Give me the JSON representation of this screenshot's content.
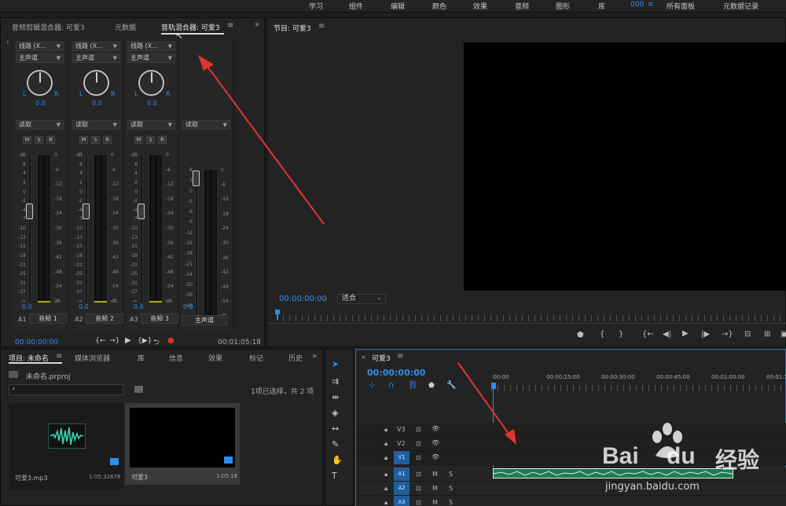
{
  "workspaces": [
    "学习",
    "组件",
    "编辑",
    "颜色",
    "效果",
    "音频",
    "图形",
    "库",
    "000",
    "所有面板",
    "元数据记录"
  ],
  "workspace_menu_glyph": "≡",
  "mixer_panel": {
    "tabs": [
      "音频剪辑混合器: 可爱3",
      "元数据",
      "音轨混合器: 可爱3"
    ],
    "menu_glyph": "≡",
    "expand_glyph": "»",
    "side_arrow": "›",
    "channels": [
      {
        "input": "线路 (X...",
        "output": "主声道",
        "pan": "0.0",
        "mode": "读取",
        "level": "0.0",
        "id": "A1",
        "name": "音频 1"
      },
      {
        "input": "线路 (X...",
        "output": "主声道",
        "pan": "0.0",
        "mode": "读取",
        "level": "0.0",
        "id": "A2",
        "name": "音频 2"
      },
      {
        "input": "线路 (X...",
        "output": "主声道",
        "pan": "0.0",
        "mode": "读取",
        "level": "0.0",
        "id": "A3",
        "name": "音频 3"
      }
    ],
    "master": {
      "mode": "读取",
      "level": "0.0",
      "name": "主声道"
    },
    "msr": [
      "M",
      "S",
      "R"
    ],
    "ms": [
      "M",
      "S"
    ],
    "pan_l": "L",
    "pan_r": "R",
    "fader_scale": [
      "dB",
      "6",
      "4",
      "2",
      "0",
      "-2",
      "-4",
      "-7",
      "-10",
      "-13",
      "-15",
      "-18",
      "-21",
      "-25",
      "-31",
      "-37",
      "-∞"
    ],
    "master_scale": [
      "6",
      "3",
      "0",
      "-3",
      "-6",
      "-9",
      "-12",
      "-15",
      "-18",
      "-21",
      "-24",
      "-30",
      "-36",
      "-45",
      "-∞"
    ],
    "meter_scale": [
      "0",
      "-6",
      "-12",
      "-18",
      "-24",
      "-30",
      "-36",
      "-42",
      "-48",
      "-54",
      "dB"
    ],
    "timecode_left": "00:00:00:00",
    "timecode_right": "00:01:05:18"
  },
  "program_monitor": {
    "title": "节目: 可爱3",
    "menu_glyph": "≡",
    "timecode": "00:00:00:00",
    "fit": "适合",
    "fit_caret": "⌄"
  },
  "project_panel": {
    "tabs": [
      "项目: 未命名",
      "媒体浏览器",
      "库",
      "信息",
      "效果",
      "标记",
      "历史"
    ],
    "menu_glyph": "≡",
    "expand_glyph": "»",
    "project_file": "未命名.prproj",
    "search_placeholder": "",
    "selection_info": "1项已选择，共 2 项",
    "items": [
      {
        "name": "可爱3.mp3",
        "duration": "1:05:32678"
      },
      {
        "name": "可爱3",
        "duration": "1:05:18"
      }
    ]
  },
  "timeline": {
    "title": "可爱3",
    "close_glyph": "×",
    "menu_glyph": "≡",
    "timecode": "00:00:00:00",
    "ruler_labels": [
      ":00:00",
      "00:00:15:00",
      "00:00:30:00",
      "00:00:45:00",
      "00:01:00:00",
      "00:01:15:00"
    ],
    "video_tracks": [
      "V3",
      "V2",
      "V1"
    ],
    "audio_tracks": [
      "A1",
      "A2",
      "A3"
    ],
    "audio_flags": [
      "M",
      "S"
    ]
  },
  "watermark": {
    "brand": "Bai",
    "brand2": "du",
    "cn": "经验",
    "url": "jingyan.baidu.com"
  },
  "colors": {
    "accent_blue": "#2e8ef0",
    "annotation_red": "#e53333",
    "clip_green": "#1f7a55"
  }
}
